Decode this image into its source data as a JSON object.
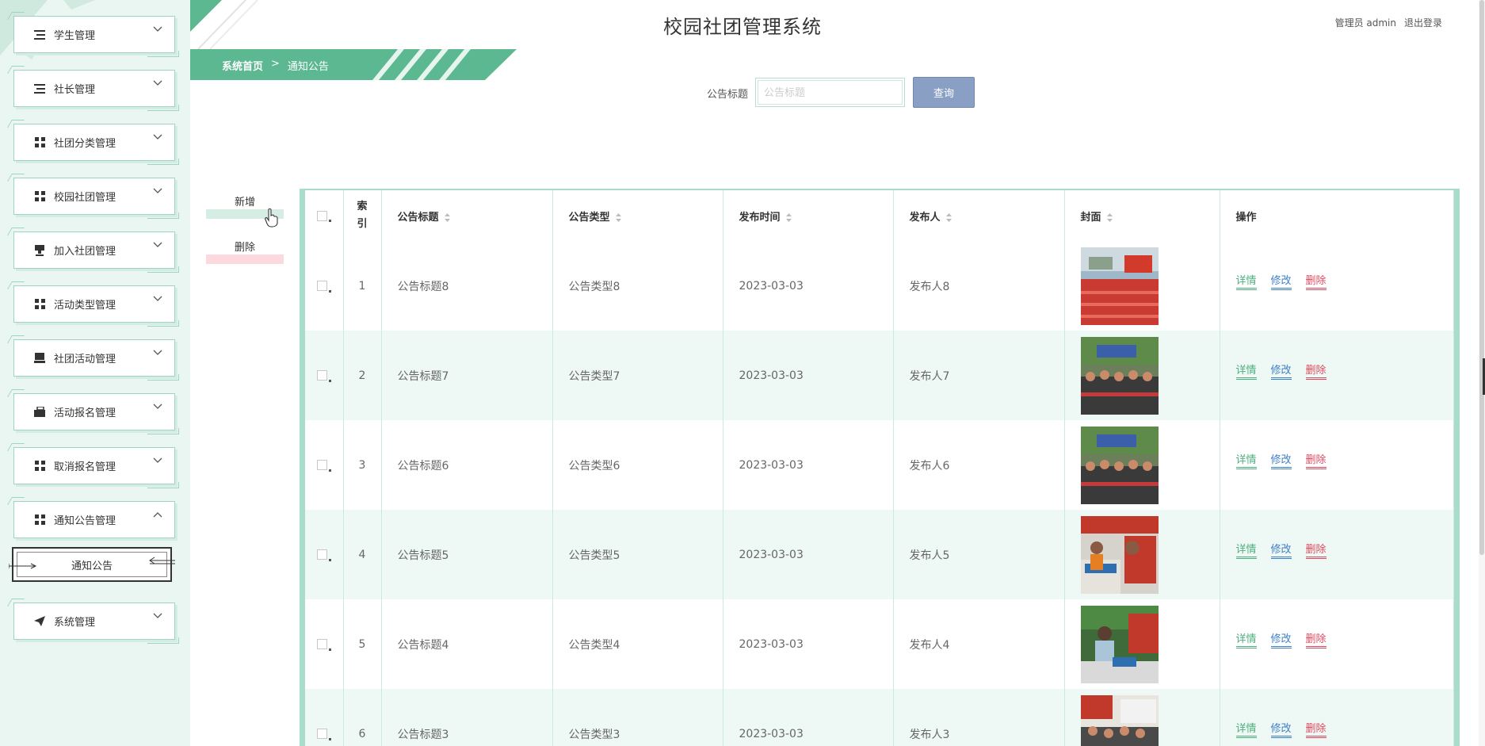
{
  "app_title": "校园社团管理系统",
  "user": {
    "role_name": "管理员 admin",
    "logout_label": "退出登录"
  },
  "breadcrumb": {
    "home": "系统首页",
    "separator": ">",
    "current": "通知公告"
  },
  "sidebar": {
    "items": [
      {
        "label": "学生管理",
        "icon": "list-icon"
      },
      {
        "label": "社长管理",
        "icon": "list-icon"
      },
      {
        "label": "社团分类管理",
        "icon": "grid-icon"
      },
      {
        "label": "校园社团管理",
        "icon": "grid-icon"
      },
      {
        "label": "加入社团管理",
        "icon": "stamp-icon"
      },
      {
        "label": "活动类型管理",
        "icon": "grid-icon"
      },
      {
        "label": "社团活动管理",
        "icon": "monitor-icon"
      },
      {
        "label": "活动报名管理",
        "icon": "briefcase-icon"
      },
      {
        "label": "取消报名管理",
        "icon": "grid-icon"
      },
      {
        "label": "通知公告管理",
        "icon": "grid-icon",
        "expanded": true
      },
      {
        "label": "系统管理",
        "icon": "send-icon"
      }
    ],
    "sub_item": "通知公告"
  },
  "search": {
    "label": "公告标题",
    "placeholder": "公告标题",
    "value": "",
    "button": "查询"
  },
  "actions": {
    "add": "新增",
    "delete": "删除"
  },
  "table": {
    "columns": [
      "索引",
      "公告标题",
      "公告类型",
      "发布时间",
      "发布人",
      "封面",
      "操作"
    ],
    "index_header": "索.\n引.",
    "ops": {
      "detail": "详情",
      "edit": "修改",
      "delete": "删除"
    },
    "rows": [
      {
        "index": "1",
        "title": "公告标题8",
        "type": "公告类型8",
        "time": "2023-03-03",
        "publisher": "发布人8"
      },
      {
        "index": "2",
        "title": "公告标题7",
        "type": "公告类型7",
        "time": "2023-03-03",
        "publisher": "发布人7"
      },
      {
        "index": "3",
        "title": "公告标题6",
        "type": "公告类型6",
        "time": "2023-03-03",
        "publisher": "发布人6"
      },
      {
        "index": "4",
        "title": "公告标题5",
        "type": "公告类型5",
        "time": "2023-03-03",
        "publisher": "发布人5"
      },
      {
        "index": "5",
        "title": "公告标题4",
        "type": "公告类型4",
        "time": "2023-03-03",
        "publisher": "发布人4"
      },
      {
        "index": "6",
        "title": "公告标题3",
        "type": "公告类型3",
        "time": "2023-03-03",
        "publisher": "发布人3"
      }
    ]
  },
  "colors": {
    "accent_green": "#5cb891",
    "sidebar_bg": "#eaf6f1",
    "query_button": "#8a9fc4",
    "delete_red": "#e04a5f",
    "edit_blue": "#3d7fc9"
  }
}
